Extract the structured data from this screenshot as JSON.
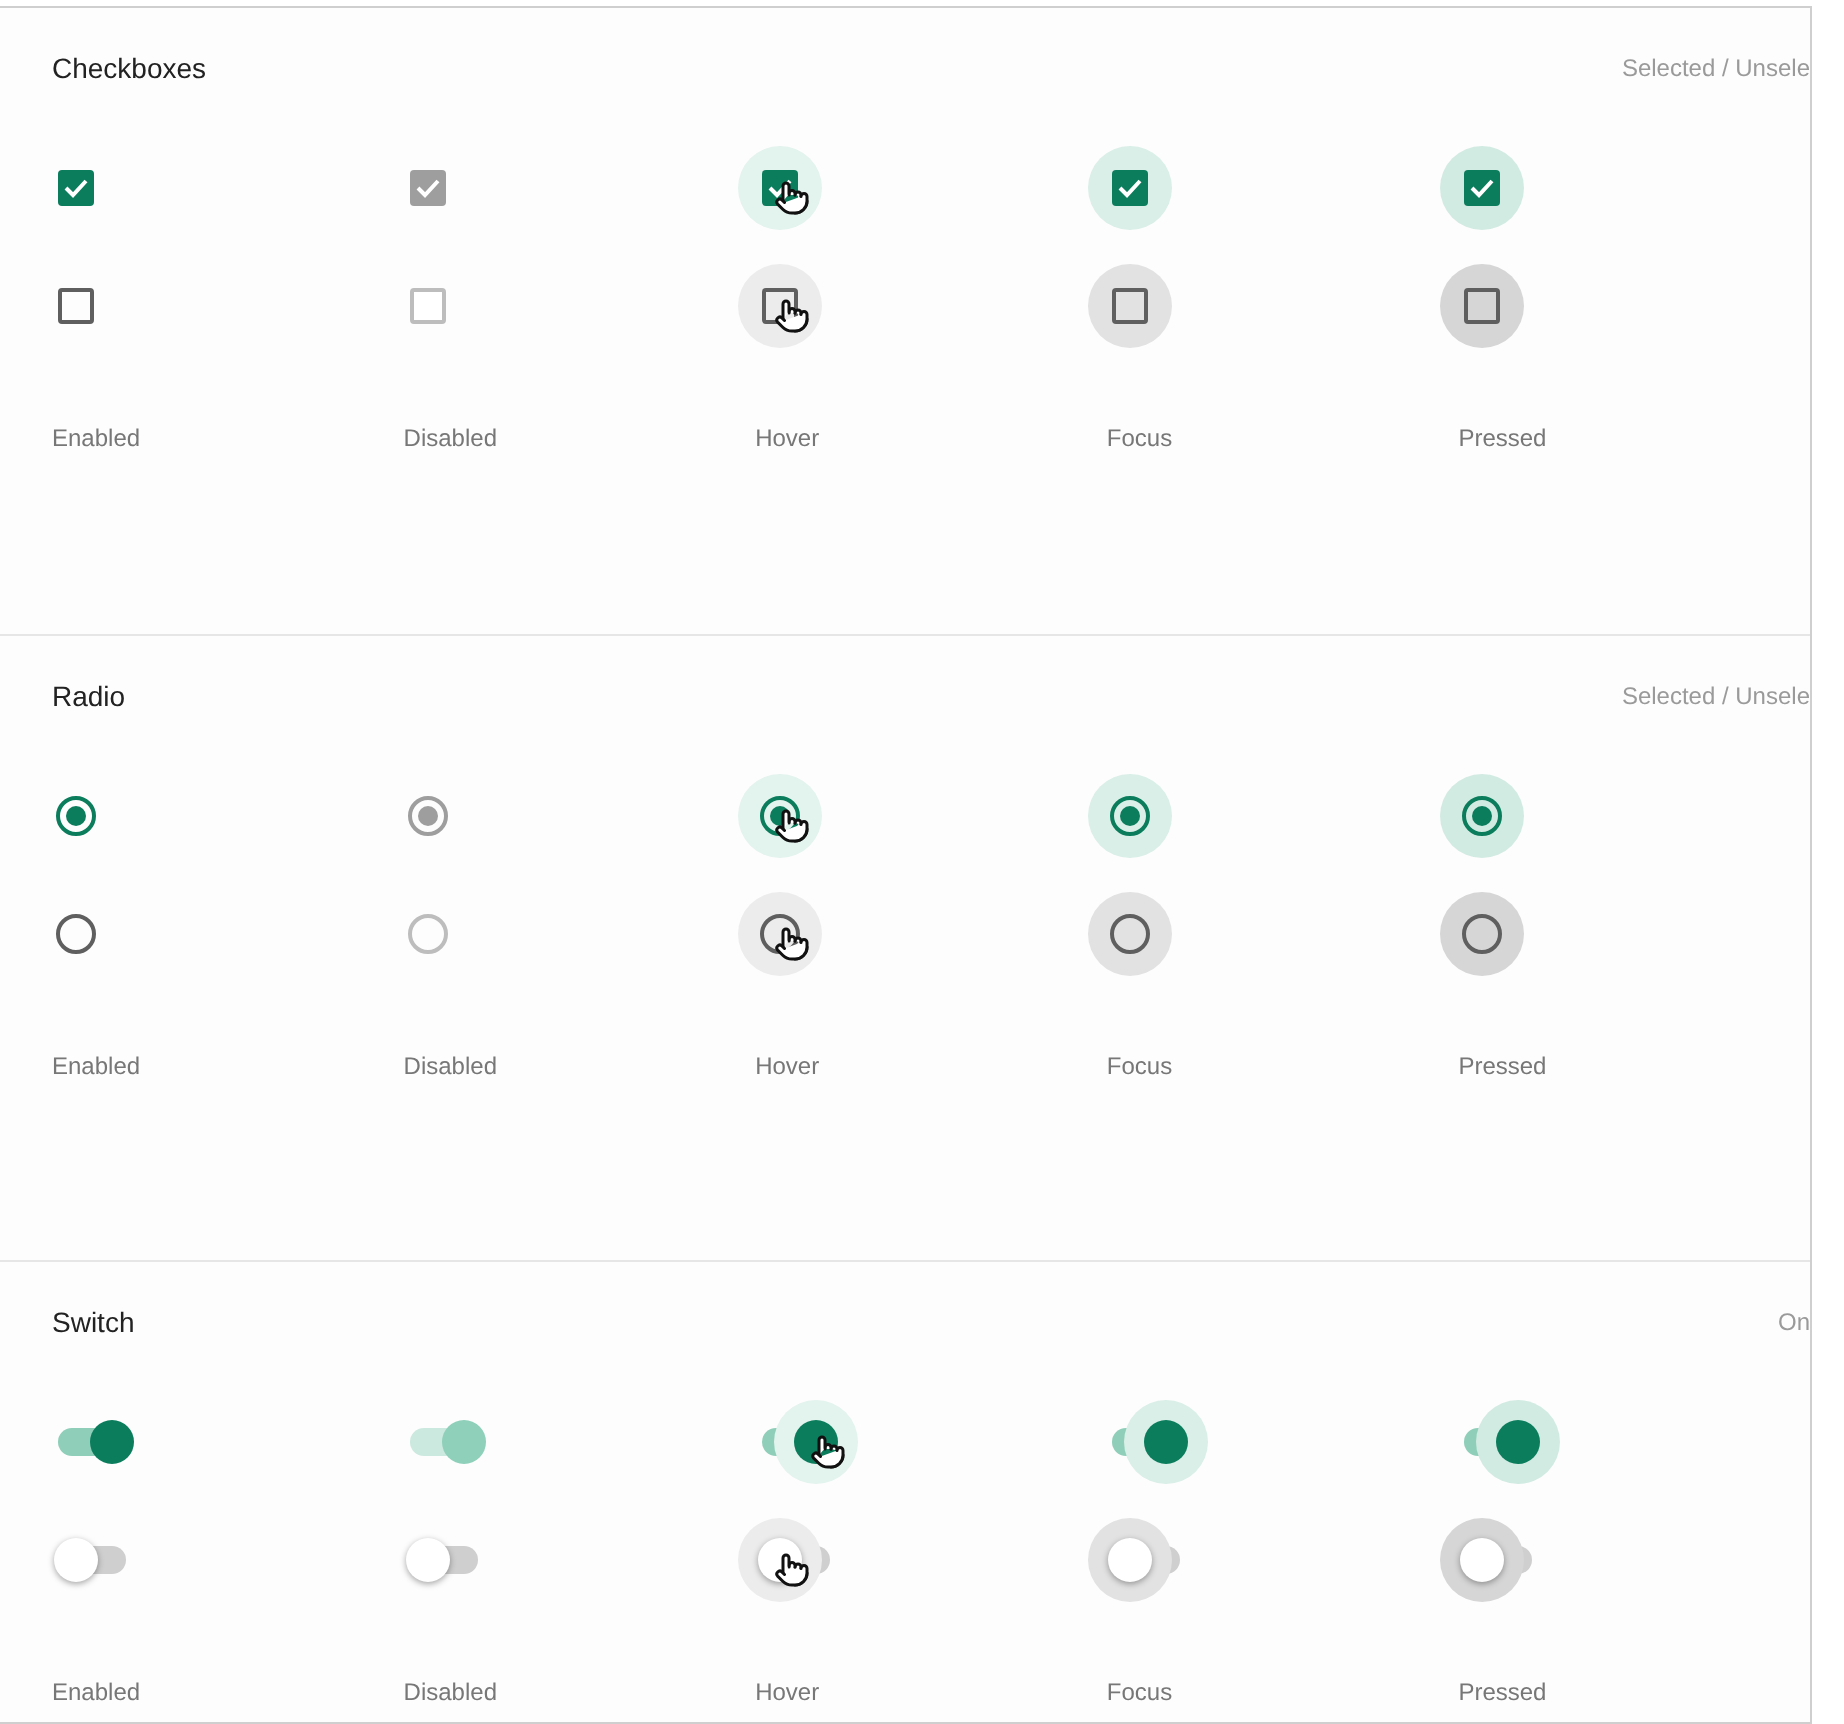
{
  "sections": [
    {
      "kind": "checkbox",
      "title": "Checkboxes",
      "legend": "Selected / Unsele",
      "columns": [
        {
          "kind": "enabled",
          "label": "Enabled",
          "controls": [
            {
              "selected": true
            },
            {
              "selected": false
            }
          ]
        },
        {
          "kind": "disabled",
          "label": "Disabled",
          "controls": [
            {
              "selected": true
            },
            {
              "selected": false
            }
          ]
        },
        {
          "kind": "hover",
          "label": "Hover",
          "controls": [
            {
              "selected": true
            },
            {
              "selected": false
            }
          ]
        },
        {
          "kind": "focus",
          "label": "Focus",
          "controls": [
            {
              "selected": true
            },
            {
              "selected": false
            }
          ]
        },
        {
          "kind": "pressed",
          "label": "Pressed",
          "controls": [
            {
              "selected": true
            },
            {
              "selected": false
            }
          ]
        }
      ]
    },
    {
      "kind": "radio",
      "title": "Radio",
      "legend": "Selected / Unsele",
      "columns": [
        {
          "kind": "enabled",
          "label": "Enabled",
          "controls": [
            {
              "selected": true
            },
            {
              "selected": false
            }
          ]
        },
        {
          "kind": "disabled",
          "label": "Disabled",
          "controls": [
            {
              "selected": true
            },
            {
              "selected": false
            }
          ]
        },
        {
          "kind": "hover",
          "label": "Hover",
          "controls": [
            {
              "selected": true
            },
            {
              "selected": false
            }
          ]
        },
        {
          "kind": "focus",
          "label": "Focus",
          "controls": [
            {
              "selected": true
            },
            {
              "selected": false
            }
          ]
        },
        {
          "kind": "pressed",
          "label": "Pressed",
          "controls": [
            {
              "selected": true
            },
            {
              "selected": false
            }
          ]
        }
      ]
    },
    {
      "kind": "switch",
      "title": "Switch",
      "legend": "On",
      "columns": [
        {
          "kind": "enabled",
          "label": "Enabled",
          "controls": [
            {
              "selected": true
            },
            {
              "selected": false
            }
          ]
        },
        {
          "kind": "disabled",
          "label": "Disabled",
          "controls": [
            {
              "selected": true
            },
            {
              "selected": false
            }
          ]
        },
        {
          "kind": "hover",
          "label": "Hover",
          "controls": [
            {
              "selected": true
            },
            {
              "selected": false
            }
          ]
        },
        {
          "kind": "focus",
          "label": "Focus",
          "controls": [
            {
              "selected": true
            },
            {
              "selected": false
            }
          ]
        },
        {
          "kind": "pressed",
          "label": "Pressed",
          "controls": [
            {
              "selected": true
            },
            {
              "selected": false
            }
          ]
        }
      ]
    }
  ]
}
